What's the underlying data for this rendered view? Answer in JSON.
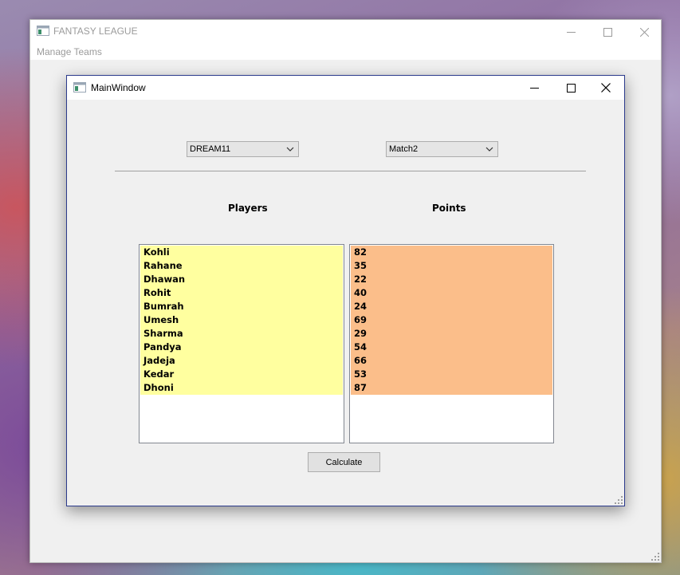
{
  "outer_window": {
    "title": "FANTASY LEAGUE",
    "menu": [
      "Manage Teams"
    ]
  },
  "inner_window": {
    "title": "MainWindow",
    "team_select": {
      "value": "DREAM11"
    },
    "match_select": {
      "value": "Match2"
    },
    "players_label": "Players",
    "points_label": "Points",
    "players": [
      "Kohli",
      "Rahane",
      "Dhawan",
      "Rohit",
      "Bumrah",
      "Umesh",
      "Sharma",
      "Pandya",
      "Jadeja",
      "Kedar",
      "Dhoni"
    ],
    "points": [
      "82",
      "35",
      "22",
      "40",
      "24",
      "69",
      "29",
      "54",
      "66",
      "53",
      "87"
    ],
    "calculate_label": "Calculate"
  },
  "colors": {
    "players_bg": "#ffff9f",
    "points_bg": "#fbbe8a",
    "inner_border": "#2b3a8c"
  },
  "icons": [
    "app-icon",
    "minimize-icon",
    "maximize-icon",
    "close-icon",
    "chevron-down-icon",
    "resize-grip-icon"
  ]
}
